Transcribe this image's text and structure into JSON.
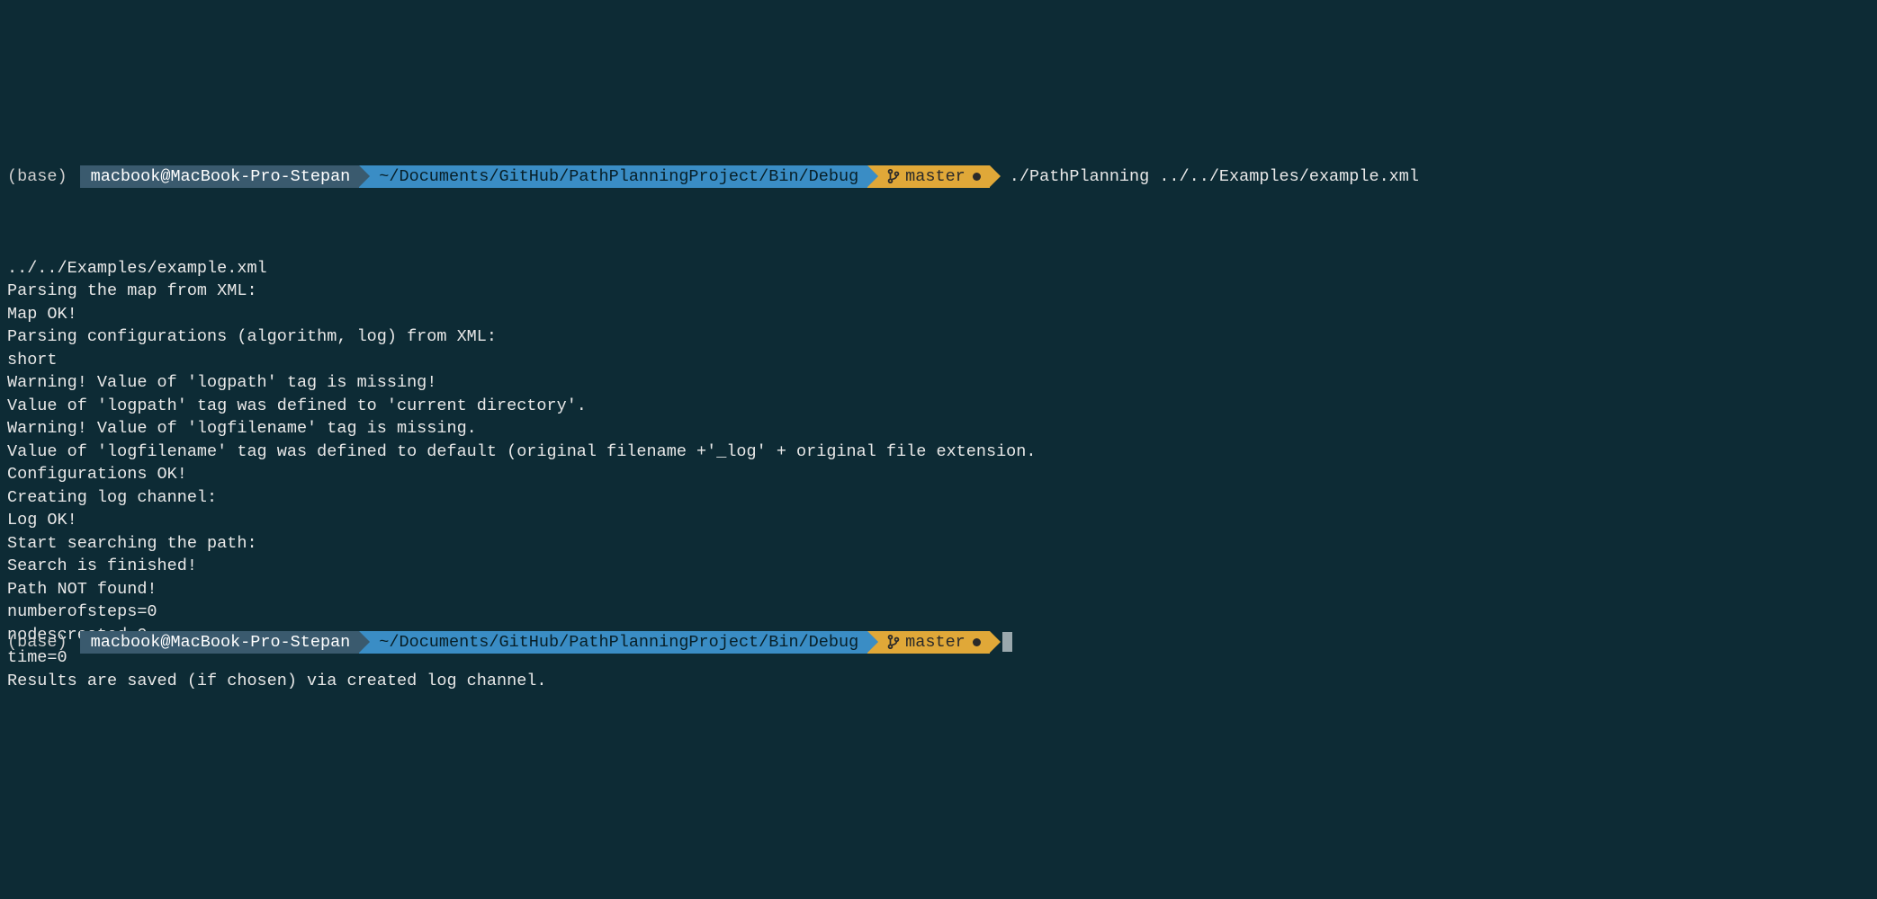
{
  "prompt1": {
    "env": "(base)",
    "user": "macbook@MacBook-Pro-Stepan",
    "path": "~/Documents/GitHub/PathPlanningProject/Bin/Debug",
    "branch": "master",
    "command": "./PathPlanning ../../Examples/example.xml"
  },
  "output": [
    "../../Examples/example.xml",
    "Parsing the map from XML:",
    "Map OK!",
    "Parsing configurations (algorithm, log) from XML:",
    "short",
    "Warning! Value of 'logpath' tag is missing!",
    "Value of 'logpath' tag was defined to 'current directory'.",
    "Warning! Value of 'logfilename' tag is missing.",
    "Value of 'logfilename' tag was defined to default (original filename +'_log' + original file extension.",
    "Configurations OK!",
    "Creating log channel:",
    "Log OK!",
    "Start searching the path:",
    "Search is finished!",
    "Path NOT found!",
    "numberofsteps=0",
    "nodescreated=0",
    "time=0",
    "Results are saved (if chosen) via created log channel."
  ],
  "prompt2": {
    "env": "(base)",
    "user": "macbook@MacBook-Pro-Stepan",
    "path": "~/Documents/GitHub/PathPlanningProject/Bin/Debug",
    "branch": "master"
  }
}
